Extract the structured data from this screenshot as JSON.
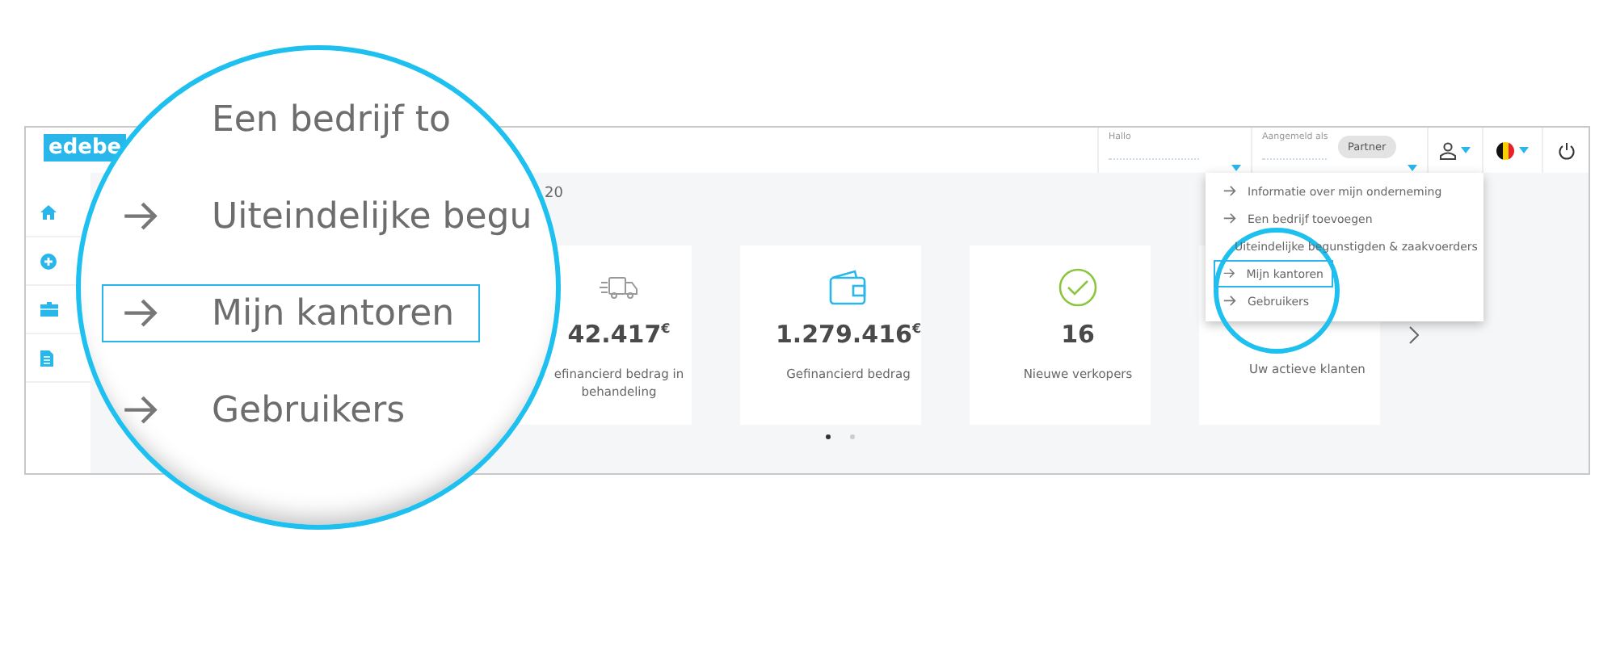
{
  "logo": {
    "text": "edebe"
  },
  "top_bar": {
    "greeting_field": {
      "label": "Hallo"
    },
    "login_field": {
      "label": "Aangemeld als",
      "role_badge": "Partner"
    }
  },
  "title_fragment": "20",
  "cards": [
    {
      "kind": "truck",
      "value": "42.417$^{€}$",
      "label": "efinancierd bedrag in behandeling"
    },
    {
      "kind": "wallet",
      "value": "1.279.416$^{€}$",
      "label": "Gefinancierd bedrag"
    },
    {
      "kind": "check",
      "value": "16",
      "label": "Nieuwe verkopers"
    },
    {
      "kind": "plain",
      "label": "Uw actieve klanten"
    }
  ],
  "carousel": {
    "dots": [
      {
        "selected": true
      },
      {
        "selected": false
      }
    ]
  },
  "dropdown": {
    "items": [
      {
        "label": "Informatie over mijn onderneming",
        "selected": false
      },
      {
        "label": "Een bedrijf toevoegen",
        "selected": false
      },
      {
        "label": "Uiteindelijke begunstigden & zaakvoerders",
        "selected": false
      },
      {
        "label": "Mijn kantoren",
        "selected": true
      },
      {
        "label": "Gebruikers",
        "selected": false
      }
    ]
  },
  "magnifier": {
    "items": [
      {
        "label": "Een bedrijf to",
        "arrow": false,
        "selected": false
      },
      {
        "label": "Uiteindelijke begu",
        "arrow": true,
        "selected": false
      },
      {
        "label": "Mijn kantoren",
        "arrow": true,
        "selected": true
      },
      {
        "label": "Gebruikers",
        "arrow": true,
        "selected": false
      }
    ]
  }
}
